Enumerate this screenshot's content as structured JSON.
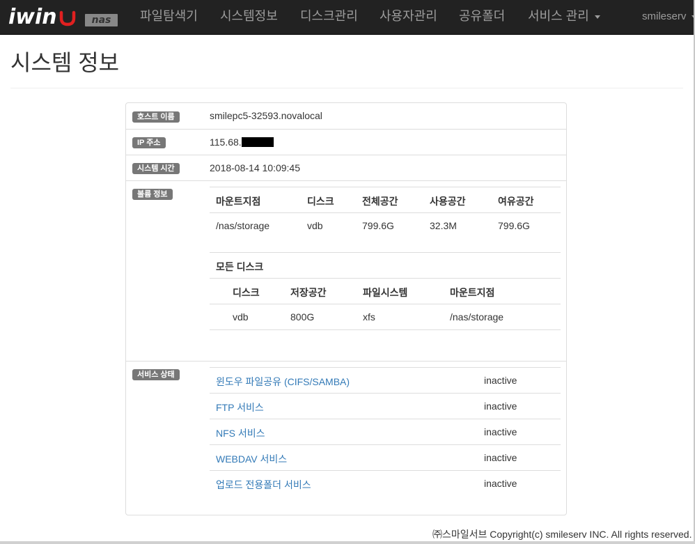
{
  "brand": {
    "logo_text": "iwin",
    "badge": "nas"
  },
  "nav": {
    "items": [
      {
        "label": "파일탐색기"
      },
      {
        "label": "시스템정보"
      },
      {
        "label": "디스크관리"
      },
      {
        "label": "사용자관리"
      },
      {
        "label": "공유폴더"
      },
      {
        "label": "서비스 관리"
      }
    ],
    "user": "smileserv"
  },
  "page": {
    "title": "시스템 정보"
  },
  "info": {
    "host": {
      "label": "호스트 이름",
      "value": "smilepc5-32593.novalocal"
    },
    "ip": {
      "label": "IP 주소",
      "value": "115.68."
    },
    "time": {
      "label": "시스템 시간",
      "value": "2018-08-14 10:09:45"
    },
    "volume": {
      "label": "볼륨 정보",
      "headers": [
        "마운트지점",
        "디스크",
        "전체공간",
        "사용공간",
        "여유공간"
      ],
      "rows": [
        [
          "/nas/storage",
          "vdb",
          "799.6G",
          "32.3M",
          "799.6G"
        ]
      ]
    },
    "disks": {
      "title": "모든 디스크",
      "headers": [
        "디스크",
        "저장공간",
        "파일시스템",
        "마운트지점"
      ],
      "rows": [
        [
          "vdb",
          "800G",
          "xfs",
          "/nas/storage"
        ]
      ]
    },
    "services": {
      "label": "서비스 상태",
      "items": [
        {
          "name": "윈도우 파일공유 (CIFS/SAMBA)",
          "status": "inactive"
        },
        {
          "name": "FTP 서비스",
          "status": "inactive"
        },
        {
          "name": "NFS 서비스",
          "status": "inactive"
        },
        {
          "name": "WEBDAV 서비스",
          "status": "inactive"
        },
        {
          "name": "업로드 전용폴더 서비스",
          "status": "inactive"
        }
      ]
    }
  },
  "footer": {
    "text": "㈜스마일서브 Copyright(c) smileserv INC. All rights reserved."
  },
  "colors": {
    "navbar": "#222222",
    "link": "#337ab7",
    "label": "#777777",
    "smile": "#e02020"
  }
}
